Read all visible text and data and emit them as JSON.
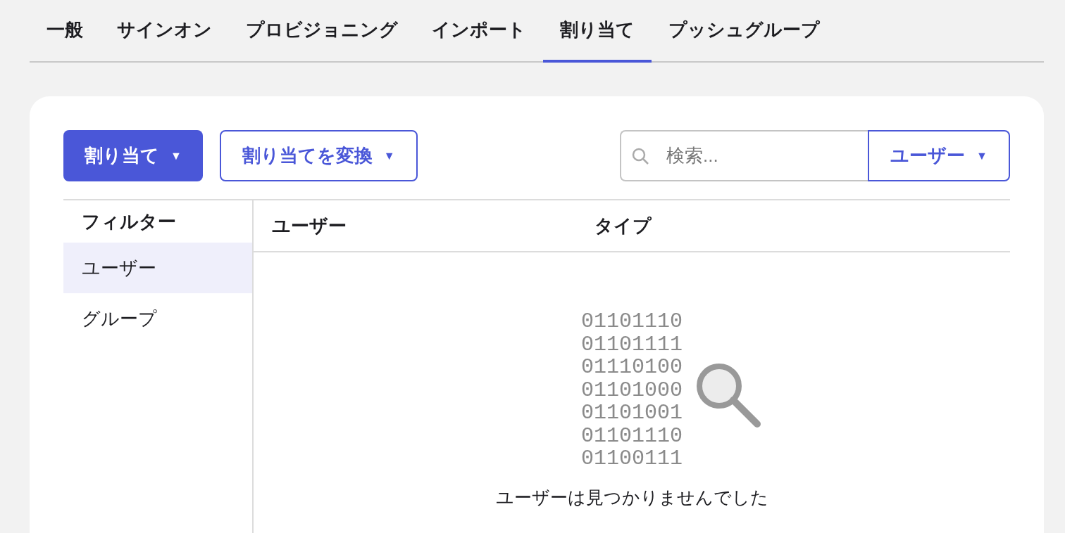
{
  "tabs": [
    {
      "label": "一般",
      "selected": false
    },
    {
      "label": "サインオン",
      "selected": false
    },
    {
      "label": "プロビジョニング",
      "selected": false
    },
    {
      "label": "インポート",
      "selected": false
    },
    {
      "label": "割り当て",
      "selected": true
    },
    {
      "label": "プッシュグループ",
      "selected": false
    }
  ],
  "toolbar": {
    "assign_button": {
      "label": "割り当て",
      "caret": "▼"
    },
    "convert_button": {
      "label": "割り当てを変換",
      "caret": "▼"
    },
    "search": {
      "placeholder": "検索..."
    },
    "scope_dropdown": {
      "label": "ユーザー",
      "caret": "▼"
    }
  },
  "filters": {
    "title": "フィルター",
    "items": [
      {
        "label": "ユーザー",
        "selected": true
      },
      {
        "label": "グループ",
        "selected": false
      }
    ]
  },
  "table": {
    "columns": [
      "ユーザー",
      "タイプ"
    ]
  },
  "empty_state": {
    "binary_lines": [
      "01101110",
      "01101111",
      "01110100",
      "01101000",
      "01101001",
      "01101110",
      "01100111"
    ],
    "message": "ユーザーは見つかりませんでした"
  }
}
